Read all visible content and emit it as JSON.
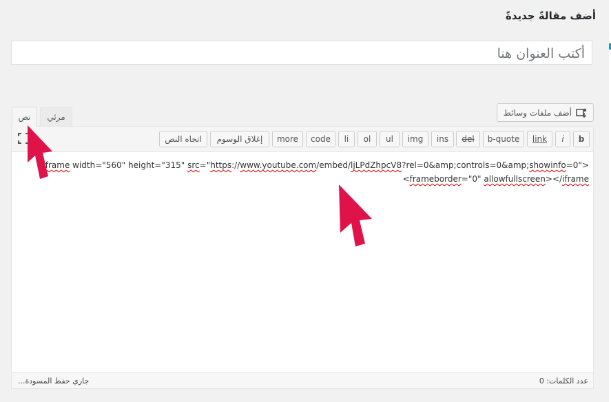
{
  "page": {
    "title": "أضف مقالةً جديدةً"
  },
  "title_field": {
    "placeholder": "أكتب العنوان هنا"
  },
  "media_button": {
    "label": "أضف ملفات وسائط",
    "icon": "media-icon"
  },
  "editor_tabs": {
    "text_tab": "نص",
    "visual_tab": "مرئي"
  },
  "toolbar": {
    "buttons": {
      "b": "b",
      "i": "i",
      "link": "link",
      "b_quote": "b-quote",
      "del": "del",
      "ins": "ins",
      "img": "img",
      "ul": "ul",
      "ol": "ol",
      "li": "li",
      "code": "code",
      "more": "more",
      "close_tags": "إغلاق الوسوم",
      "text_direction": "اتجاه النص"
    },
    "fullscreen_icon": "fullscreen-icon"
  },
  "content": {
    "line1": {
      "p1": "iframe",
      "p2": " width=\"560\" height=\"315\" ",
      "p3": "src",
      "p4": "=\"",
      "p5": "https",
      "p6": "://",
      "p7": "www.youtube.com",
      "p8": "/embed/",
      "p9": "ljLPdZhpcV8",
      "p10": "?rel=0&amp;controls=0&amp;",
      "p11": "showinfo",
      "p12": "=0\">"
    },
    "line2": {
      "p1": "<",
      "p2": "frameborder",
      "p3": "=\"0\" ",
      "p4": "allowfullscreen",
      "p5": "></",
      "p6": "iframe"
    }
  },
  "status_bar": {
    "word_count": "عدد الكلمات: 0",
    "draft_status": "جاري حفظ المسودة..."
  },
  "colors": {
    "arrow": "#e0124a",
    "accent": "#00a0d2",
    "background": "#f1f1f1"
  }
}
